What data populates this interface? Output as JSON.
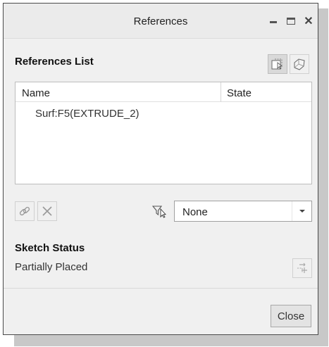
{
  "window": {
    "title": "References"
  },
  "references": {
    "section_title": "References List",
    "columns": {
      "name": "Name",
      "state": "State"
    },
    "rows": [
      {
        "name": "Surf:F5(EXTRUDE_2)",
        "state": ""
      }
    ]
  },
  "filter": {
    "selected": "None"
  },
  "sketch": {
    "section_title": "Sketch Status",
    "status": "Partially Placed"
  },
  "footer": {
    "close_label": "Close"
  },
  "icons": {
    "minimize": "minimize-icon",
    "maximize": "maximize-icon",
    "close": "close-icon",
    "select_reference": "select-reference-icon",
    "cross_section": "cross-section-icon",
    "link": "link-icon",
    "delete": "delete-x-icon",
    "filter": "filter-cursor-icon",
    "dropdown": "chevron-down-icon",
    "solve": "solve-reference-icon"
  }
}
